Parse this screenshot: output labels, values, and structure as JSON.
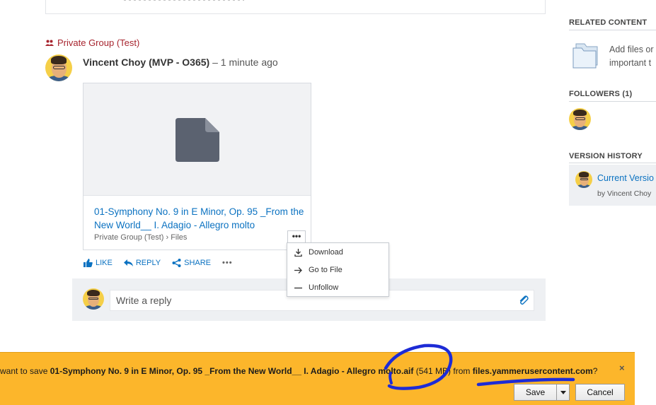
{
  "feed": {
    "group_name": "Private Group (Test)",
    "post": {
      "author": "Vincent Choy (MVP - O365)",
      "time": "– 1 minute ago"
    },
    "file": {
      "name": "01-Symphony No. 9 in E Minor, Op. 95 _From the New World__ I. Adagio - Allegro molto",
      "path": "Private Group (Test) › Files",
      "more_label": "•••"
    },
    "actions": {
      "like": "LIKE",
      "reply": "REPLY",
      "share": "SHARE",
      "more": "•••"
    },
    "file_menu": {
      "items": [
        {
          "label": "Download",
          "icon": "download-icon"
        },
        {
          "label": "Go to File",
          "icon": "arrow-right-icon"
        },
        {
          "label": "Unfollow",
          "icon": "minus-icon"
        }
      ]
    },
    "reply_box": {
      "placeholder": "Write a reply"
    }
  },
  "sidebar": {
    "related": {
      "title": "RELATED CONTENT",
      "text_line1": "Add files or",
      "text_line2": "important t"
    },
    "followers": {
      "title": "FOLLOWERS (1)"
    },
    "version_history": {
      "title": "VERSION HISTORY",
      "current": "Current Versio",
      "by": "by Vincent Choy"
    }
  },
  "download_bar": {
    "msg_prefix": "want to save ",
    "file_name": "01-Symphony No. 9 in E Minor, Op. 95 _From the New World__ I. Adagio - Allegro molto",
    "file_ext": ".aif",
    "size": "(541 MB)",
    "from_text": " from ",
    "host": "files.yammerusercontent.com",
    "question": "?",
    "save_label": "Save",
    "cancel_label": "Cancel",
    "close_label": "×"
  },
  "colors": {
    "group_red": "#a7242e",
    "link_blue": "#0b72c1",
    "bar_orange": "#fcb62b",
    "ink_blue": "#1d2bd6"
  }
}
